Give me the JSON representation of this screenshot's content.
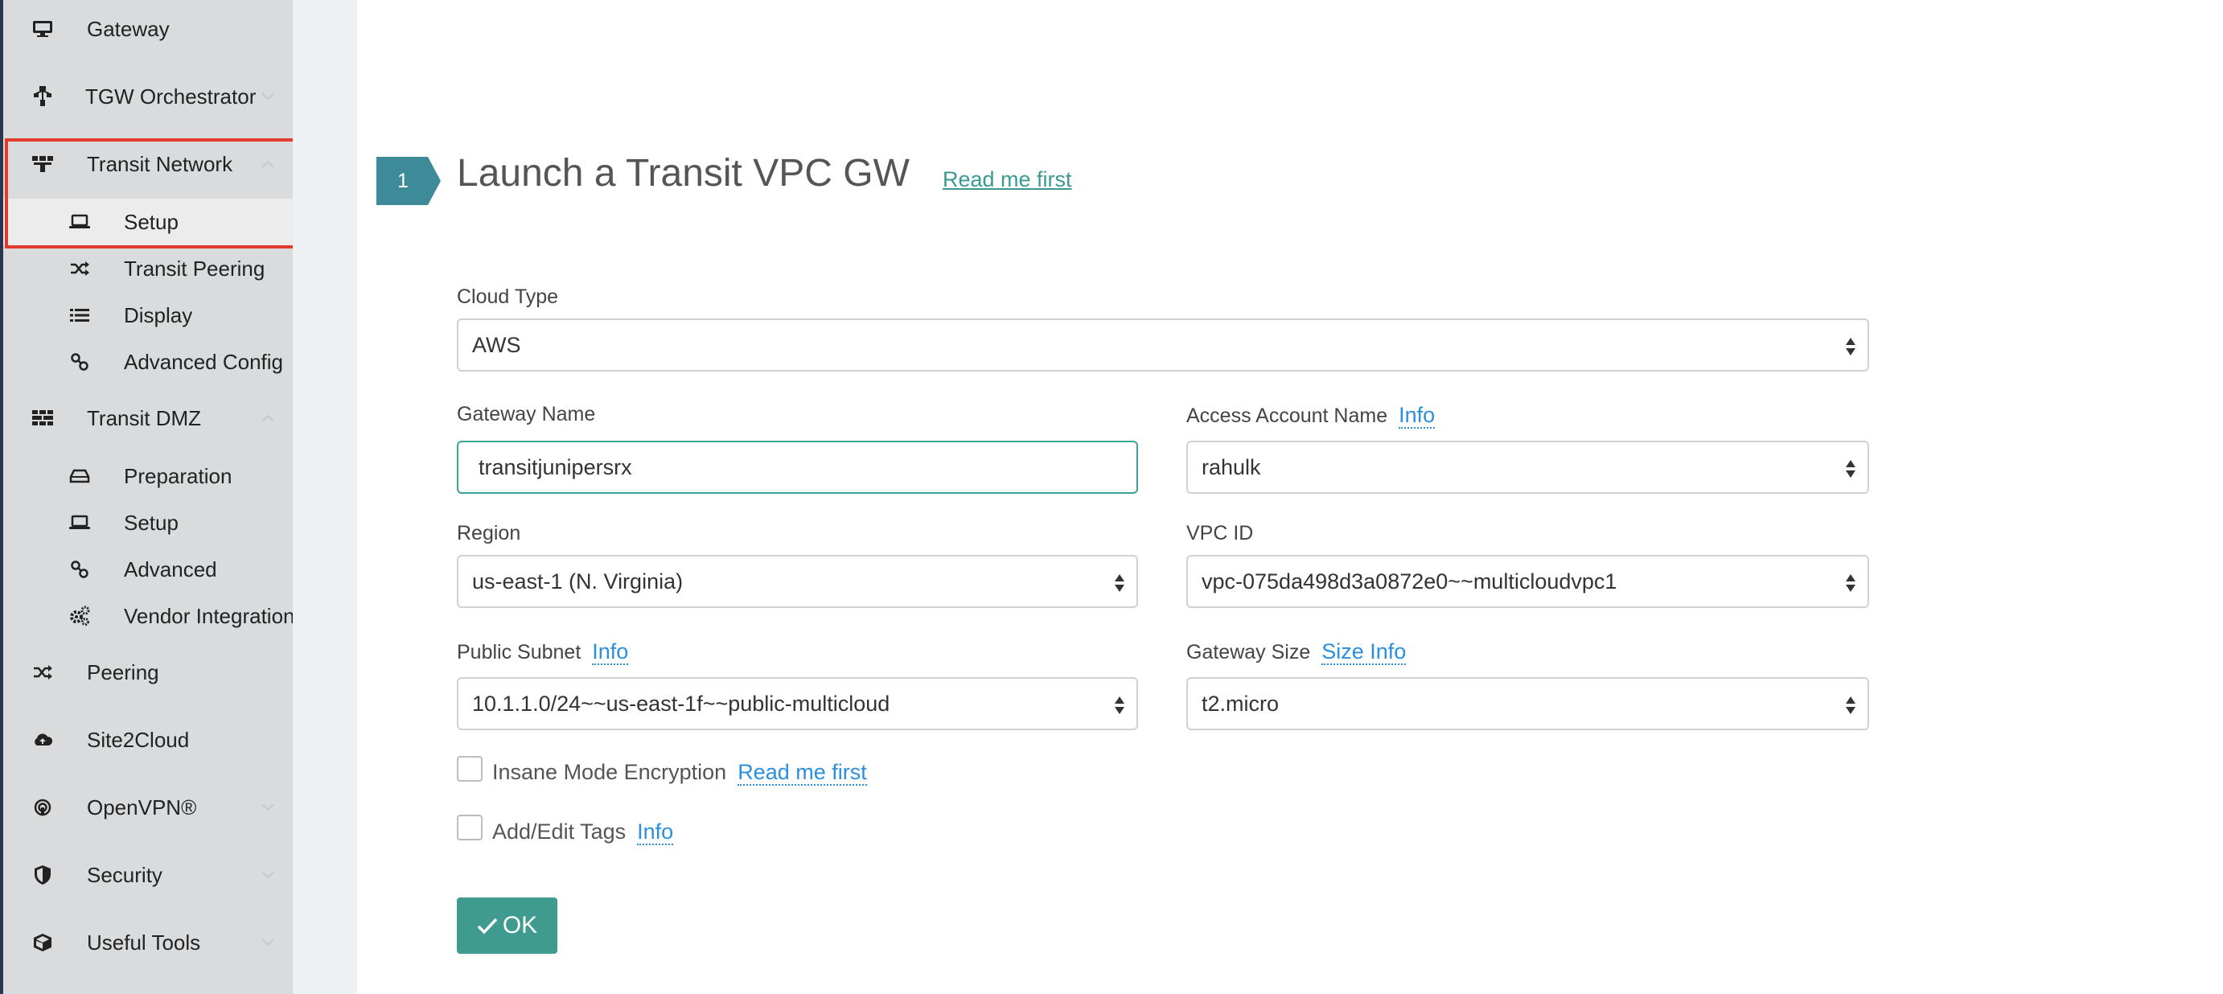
{
  "sidebar": {
    "items": [
      {
        "label": "Gateway",
        "icon": "monitor-icon"
      },
      {
        "label": "TGW Orchestrator",
        "icon": "tgw-icon"
      },
      {
        "label": "Transit Network",
        "icon": "network-icon"
      },
      {
        "label": "Transit DMZ",
        "icon": "firewall-icon"
      },
      {
        "label": "Peering",
        "icon": "shuffle-icon"
      },
      {
        "label": "Site2Cloud",
        "icon": "cloud-upload-icon"
      },
      {
        "label": "OpenVPN®",
        "icon": "vpn-icon"
      },
      {
        "label": "Security",
        "icon": "shield-icon"
      },
      {
        "label": "Useful Tools",
        "icon": "cube-icon"
      }
    ],
    "transit_network_sub": [
      {
        "label": "Setup",
        "icon": "laptop-icon"
      },
      {
        "label": "Transit Peering",
        "icon": "shuffle-icon"
      },
      {
        "label": "Display",
        "icon": "list-icon"
      },
      {
        "label": "Advanced Config",
        "icon": "link-icon"
      }
    ],
    "transit_dmz_sub": [
      {
        "label": "Preparation",
        "icon": "hdd-icon"
      },
      {
        "label": "Setup",
        "icon": "laptop-icon"
      },
      {
        "label": "Advanced",
        "icon": "link-icon"
      },
      {
        "label": "Vendor Integration",
        "icon": "gears-icon"
      }
    ],
    "highlight_color": "#e23a2f"
  },
  "step": {
    "number": "1",
    "title": "Launch a Transit VPC GW",
    "read_me_link": "Read me first"
  },
  "form": {
    "cloud_type": {
      "label": "Cloud Type",
      "value": "AWS"
    },
    "gateway_name": {
      "label": "Gateway Name",
      "value": "transitjunipersrx"
    },
    "access_account": {
      "label": "Access Account Name",
      "info": "Info",
      "value": "rahulk"
    },
    "region": {
      "label": "Region",
      "value": "us-east-1 (N. Virginia)"
    },
    "vpc_id": {
      "label": "VPC ID",
      "value": "vpc-075da498d3a0872e0~~multicloudvpc1"
    },
    "public_subnet": {
      "label": "Public Subnet",
      "info": "Info",
      "value": "10.1.1.0/24~~us-east-1f~~public-multicloud"
    },
    "gateway_size": {
      "label": "Gateway Size",
      "info": "Size Info",
      "value": "t2.micro"
    },
    "insane_mode": {
      "label": "Insane Mode Encryption",
      "link": "Read me first",
      "checked": false
    },
    "tags": {
      "label": "Add/Edit Tags",
      "link": "Info",
      "checked": false
    },
    "ok_button": {
      "label": "OK",
      "icon": "checkmark-icon"
    }
  },
  "colors": {
    "accent_teal": "#3f9a8f",
    "link_blue": "#2b8fe0",
    "sidebar_bg": "#d9dbdc",
    "step_badge": "#3d8a98"
  }
}
